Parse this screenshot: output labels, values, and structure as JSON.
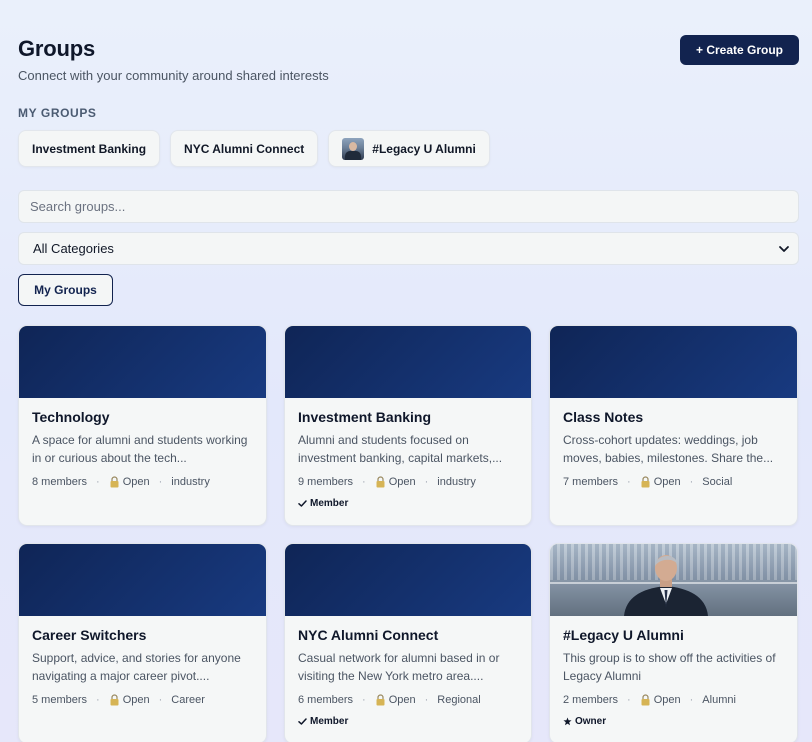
{
  "header": {
    "title": "Groups",
    "subtitle": "Connect with your community around shared interests",
    "create_label": "+ Create Group"
  },
  "my_groups": {
    "label": "MY GROUPS",
    "chips": [
      "Investment Banking",
      "NYC Alumni Connect",
      "#Legacy U Alumni"
    ]
  },
  "search": {
    "placeholder": "Search groups..."
  },
  "category_select": {
    "selected": "All Categories"
  },
  "filter": {
    "my_groups_label": "My Groups"
  },
  "cards": [
    {
      "title": "Technology",
      "description": "A space for alumni and students working in or curious about the tech...",
      "members": "8 members",
      "access": "Open",
      "category": "industry",
      "badge": ""
    },
    {
      "title": "Investment Banking",
      "description": "Alumni and students focused on investment banking, capital markets,...",
      "members": "9 members",
      "access": "Open",
      "category": "industry",
      "badge": "Member"
    },
    {
      "title": "Class Notes",
      "description": "Cross-cohort updates: weddings, job moves, babies, milestones. Share the...",
      "members": "7 members",
      "access": "Open",
      "category": "Social",
      "badge": ""
    },
    {
      "title": "Career Switchers",
      "description": "Support, advice, and stories for anyone navigating a major career pivot....",
      "members": "5 members",
      "access": "Open",
      "category": "Career",
      "badge": ""
    },
    {
      "title": "NYC Alumni Connect",
      "description": "Casual network for alumni based in or visiting the New York metro area....",
      "members": "6 members",
      "access": "Open",
      "category": "Regional",
      "badge": "Member"
    },
    {
      "title": "#Legacy U Alumni",
      "description": "This group is to show off the activities of Legacy Alumni",
      "members": "2 members",
      "access": "Open",
      "category": "Alumni",
      "badge": "Owner"
    }
  ],
  "icons": {
    "lock": "lock-icon",
    "check": "check-icon",
    "star": "star-icon",
    "chevron": "chevron-down-icon"
  },
  "colors": {
    "primary": "#12234f",
    "banner": "#12295e",
    "card_bg": "#f5f7f7"
  }
}
